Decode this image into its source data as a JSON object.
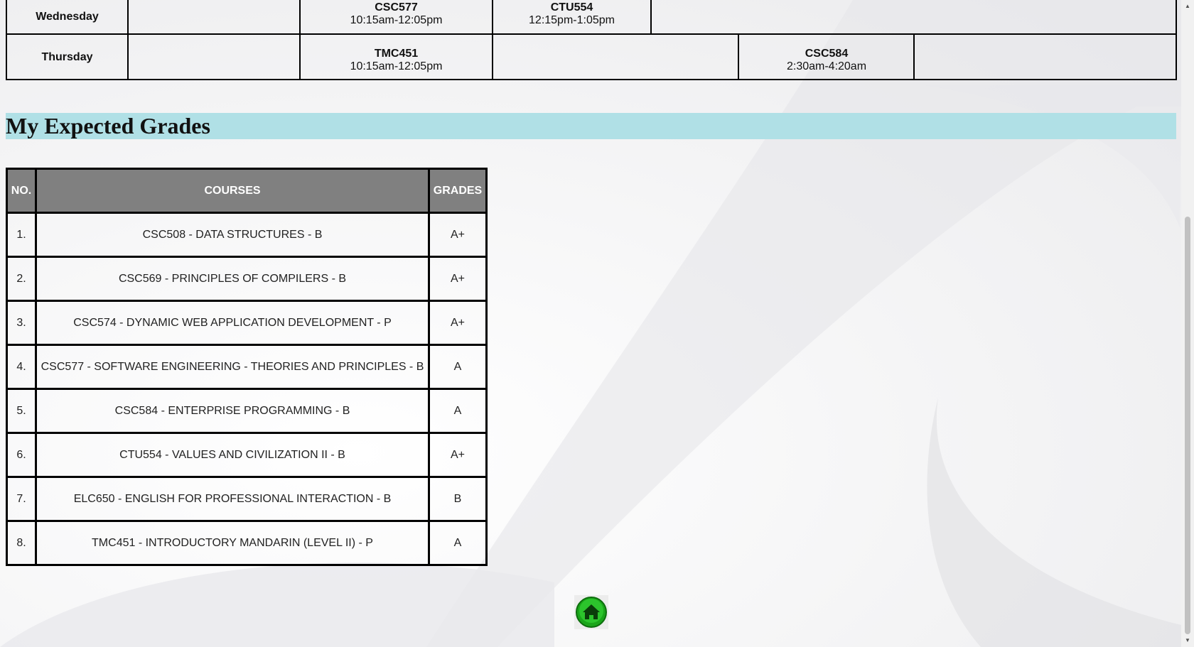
{
  "timetable": {
    "rows": [
      {
        "day": "Wednesday",
        "slots": [
          {
            "code": "CSC577",
            "time": "10:15am-12:05pm"
          },
          {
            "code": "CTU554",
            "time": "12:15pm-1:05pm"
          }
        ]
      },
      {
        "day": "Thursday",
        "slots": [
          {
            "code": "TMC451",
            "time": "10:15am-12:05pm"
          },
          {
            "code": "CSC584",
            "time": "2:30am-4:20am"
          }
        ]
      }
    ]
  },
  "grades_section": {
    "heading": "My Expected Grades",
    "columns": [
      "NO.",
      "COURSES",
      "GRADES"
    ],
    "rows": [
      {
        "no": "1.",
        "course": "CSC508 - DATA STRUCTURES - B",
        "grade": "A+"
      },
      {
        "no": "2.",
        "course": "CSC569 - PRINCIPLES OF COMPILERS - B",
        "grade": "A+"
      },
      {
        "no": "3.",
        "course": "CSC574 - DYNAMIC WEB APPLICATION DEVELOPMENT - P",
        "grade": "A+"
      },
      {
        "no": "4.",
        "course": "CSC577 - SOFTWARE ENGINEERING - THEORIES AND PRINCIPLES - B",
        "grade": "A"
      },
      {
        "no": "5.",
        "course": "CSC584 - ENTERPRISE PROGRAMMING - B",
        "grade": "A"
      },
      {
        "no": "6.",
        "course": "CTU554 - VALUES AND CIVILIZATION II - B",
        "grade": "A+"
      },
      {
        "no": "7.",
        "course": "ELC650 - ENGLISH FOR PROFESSIONAL INTERACTION - B",
        "grade": "B"
      },
      {
        "no": "8.",
        "course": "TMC451 - INTRODUCTORY MANDARIN (LEVEL II) - P",
        "grade": "A"
      }
    ]
  },
  "home_button": {
    "icon": "home-icon",
    "color": "#22c022"
  },
  "colors": {
    "heading_bg": "#b0e0e6",
    "table_header_bg": "#808080",
    "page_bg": "#f2f2f3"
  }
}
